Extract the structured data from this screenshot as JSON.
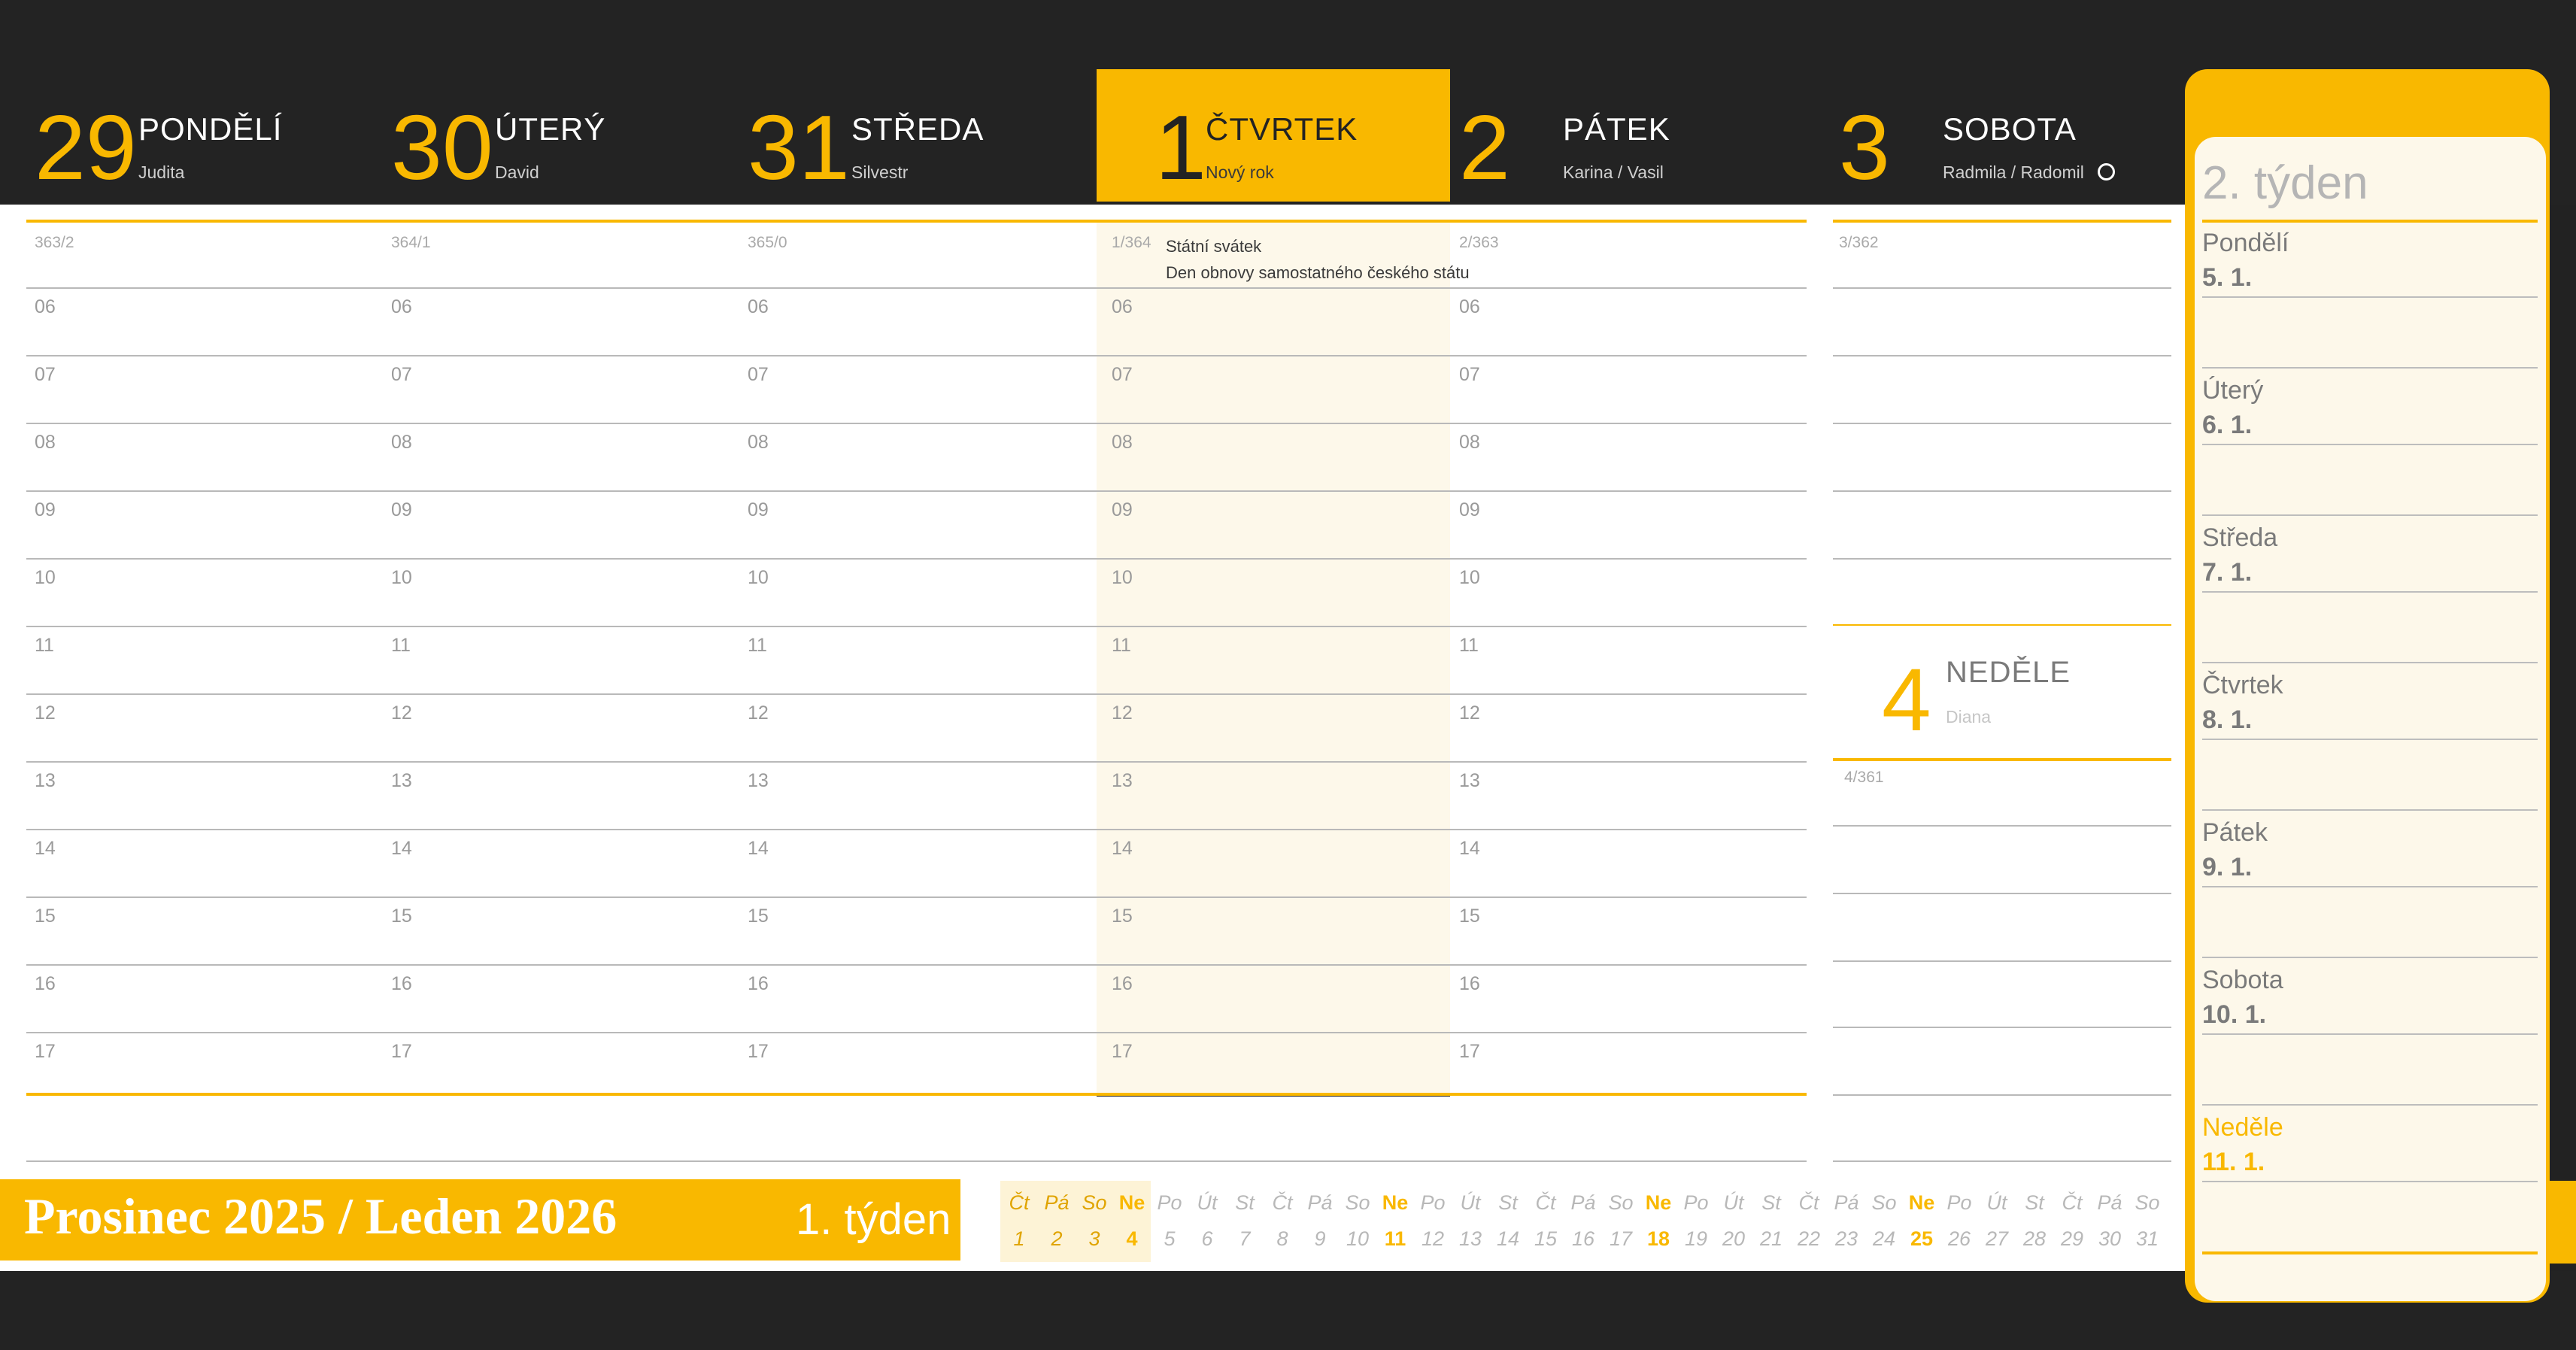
{
  "days": [
    {
      "num": "29",
      "name": "PONDĚLÍ",
      "nameday": "Judita",
      "daynum": "363/2",
      "highlight": false,
      "moon": false
    },
    {
      "num": "30",
      "name": "ÚTERÝ",
      "nameday": "David",
      "daynum": "364/1",
      "highlight": false,
      "moon": false
    },
    {
      "num": "31",
      "name": "STŘEDA",
      "nameday": "Silvestr",
      "daynum": "365/0",
      "highlight": false,
      "moon": false
    },
    {
      "num": "1",
      "name": "ČTVRTEK",
      "nameday": "Nový rok",
      "daynum": "1/364",
      "highlight": true,
      "moon": false
    },
    {
      "num": "2",
      "name": "PÁTEK",
      "nameday": "Karina / Vasil",
      "daynum": "2/363",
      "highlight": false,
      "moon": false
    },
    {
      "num": "3",
      "name": "SOBOTA",
      "nameday": "Radmila / Radomil",
      "daynum": "3/362",
      "highlight": false,
      "moon": true
    }
  ],
  "sunday": {
    "num": "4",
    "name": "NEDĚLE",
    "nameday": "Diana",
    "daynum": "4/361"
  },
  "holiday": {
    "line1": "Státní svátek",
    "line2": "Den obnovy samostatného českého státu"
  },
  "hours": [
    "06",
    "07",
    "08",
    "09",
    "10",
    "11",
    "12",
    "13",
    "14",
    "15",
    "16",
    "17"
  ],
  "footer": {
    "month": "Prosinec 2025 / Leden 2026",
    "week": "1. týden"
  },
  "mini_calendar": [
    {
      "d": "Čt",
      "n": "1"
    },
    {
      "d": "Pá",
      "n": "2"
    },
    {
      "d": "So",
      "n": "3"
    },
    {
      "d": "Ne",
      "n": "4"
    },
    {
      "d": "Po",
      "n": "5"
    },
    {
      "d": "Út",
      "n": "6"
    },
    {
      "d": "St",
      "n": "7"
    },
    {
      "d": "Čt",
      "n": "8"
    },
    {
      "d": "Pá",
      "n": "9"
    },
    {
      "d": "So",
      "n": "10"
    },
    {
      "d": "Ne",
      "n": "11"
    },
    {
      "d": "Po",
      "n": "12"
    },
    {
      "d": "Út",
      "n": "13"
    },
    {
      "d": "St",
      "n": "14"
    },
    {
      "d": "Čt",
      "n": "15"
    },
    {
      "d": "Pá",
      "n": "16"
    },
    {
      "d": "So",
      "n": "17"
    },
    {
      "d": "Ne",
      "n": "18"
    },
    {
      "d": "Po",
      "n": "19"
    },
    {
      "d": "Út",
      "n": "20"
    },
    {
      "d": "St",
      "n": "21"
    },
    {
      "d": "Čt",
      "n": "22"
    },
    {
      "d": "Pá",
      "n": "23"
    },
    {
      "d": "So",
      "n": "24"
    },
    {
      "d": "Ne",
      "n": "25"
    },
    {
      "d": "Po",
      "n": "26"
    },
    {
      "d": "Út",
      "n": "27"
    },
    {
      "d": "St",
      "n": "28"
    },
    {
      "d": "Čt",
      "n": "29"
    },
    {
      "d": "Pá",
      "n": "30"
    },
    {
      "d": "So",
      "n": "31"
    }
  ],
  "next_week": {
    "title": "2. týden",
    "days": [
      {
        "name": "Pondělí",
        "date": "5. 1."
      },
      {
        "name": "Úterý",
        "date": "6. 1."
      },
      {
        "name": "Středa",
        "date": "7. 1."
      },
      {
        "name": "Čtvrtek",
        "date": "8. 1."
      },
      {
        "name": "Pátek",
        "date": "9. 1."
      },
      {
        "name": "Sobota",
        "date": "10. 1."
      },
      {
        "name": "Neděle",
        "date": "11. 1."
      }
    ]
  },
  "colors": {
    "accent": "#f9b800",
    "dark": "#232323",
    "cream": "#fdf8ea"
  }
}
